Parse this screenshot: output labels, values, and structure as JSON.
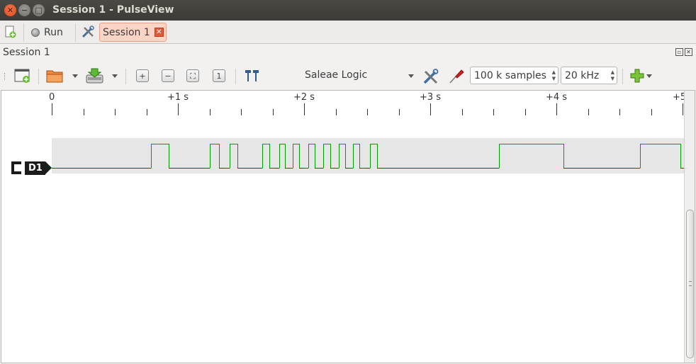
{
  "window": {
    "title": "Session 1 - PulseView"
  },
  "tabbar": {
    "run_label": "Run",
    "session_tab_label": "Session 1",
    "tab_close_glyph": "✕"
  },
  "dock": {
    "title": "Session 1"
  },
  "toolbar": {
    "device": "Saleae Logic",
    "samples": "100 k samples",
    "samplerate": "20 kHz"
  },
  "ruler": {
    "labels": [
      "0",
      "+1 s",
      "+2 s",
      "+3 s",
      "+4 s",
      "+5"
    ]
  },
  "channel": {
    "name": "D1",
    "high_color": "#00a000",
    "low_color": "#c00000"
  }
}
